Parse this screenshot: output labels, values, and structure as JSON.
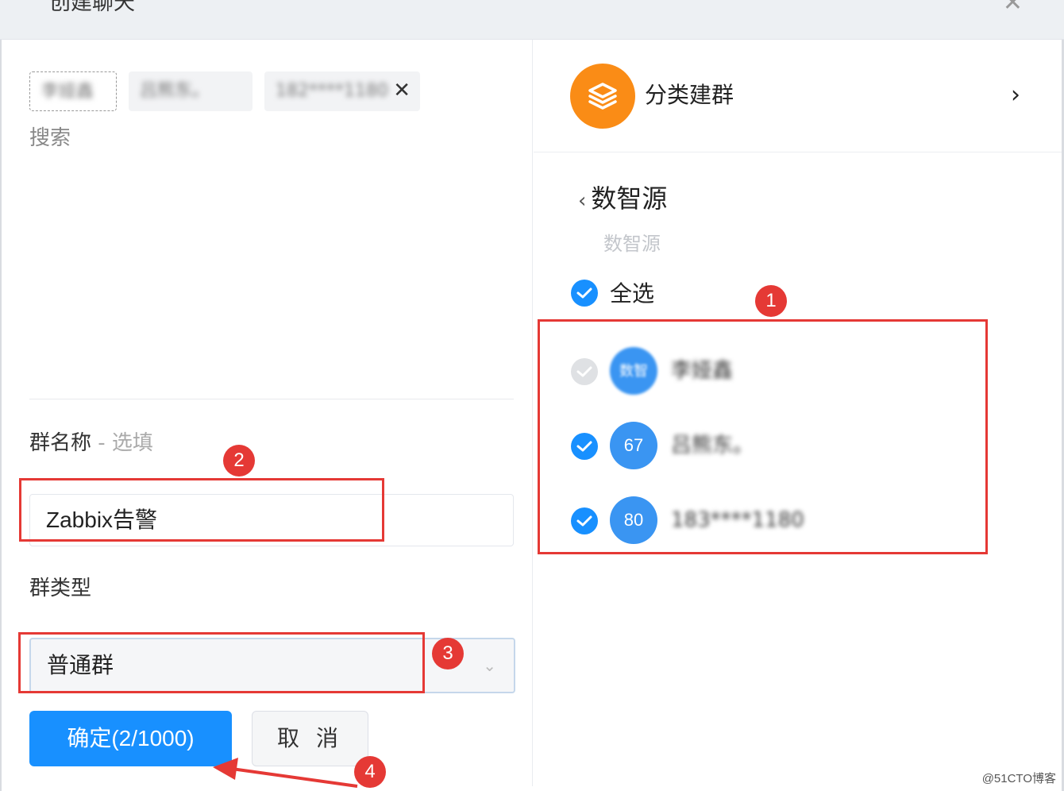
{
  "dialog": {
    "title": "创建聊天",
    "close_icon": "close-icon"
  },
  "left": {
    "selected_chips": [
      {
        "label": "李娅鑫"
      },
      {
        "label": "吕熊东。"
      },
      {
        "label": "182****1180",
        "removable": true,
        "remove_glyph": "✕"
      }
    ],
    "search_placeholder": "搜索",
    "group_name": {
      "label": "群名称",
      "optional_hint": "- 选填",
      "value": "Zabbix告警"
    },
    "group_type": {
      "label": "群类型",
      "value": "普通群",
      "chevron": "⌄"
    },
    "confirm_label": "确定(2/1000)",
    "cancel_label": "取 消"
  },
  "right": {
    "category": {
      "label": "分类建群",
      "icon": "layers-icon",
      "arrow": "›"
    },
    "back_title": "数智源",
    "back_chevron": "‹",
    "breadcrumb": "数智源",
    "select_all_label": "全选",
    "members": [
      {
        "avatar": "数智",
        "name": "李娅鑫",
        "checked": true,
        "disabled": true
      },
      {
        "avatar": "67",
        "name": "吕熊东。",
        "checked": true,
        "disabled": false
      },
      {
        "avatar": "80",
        "name": "183****1180",
        "checked": true,
        "disabled": false
      }
    ]
  },
  "annotations": [
    "1",
    "2",
    "3",
    "4"
  ],
  "colors": {
    "primary": "#1890ff",
    "accent_orange": "#fa8c16",
    "annotation_red": "#e53935"
  },
  "watermark": "@51CTO博客"
}
